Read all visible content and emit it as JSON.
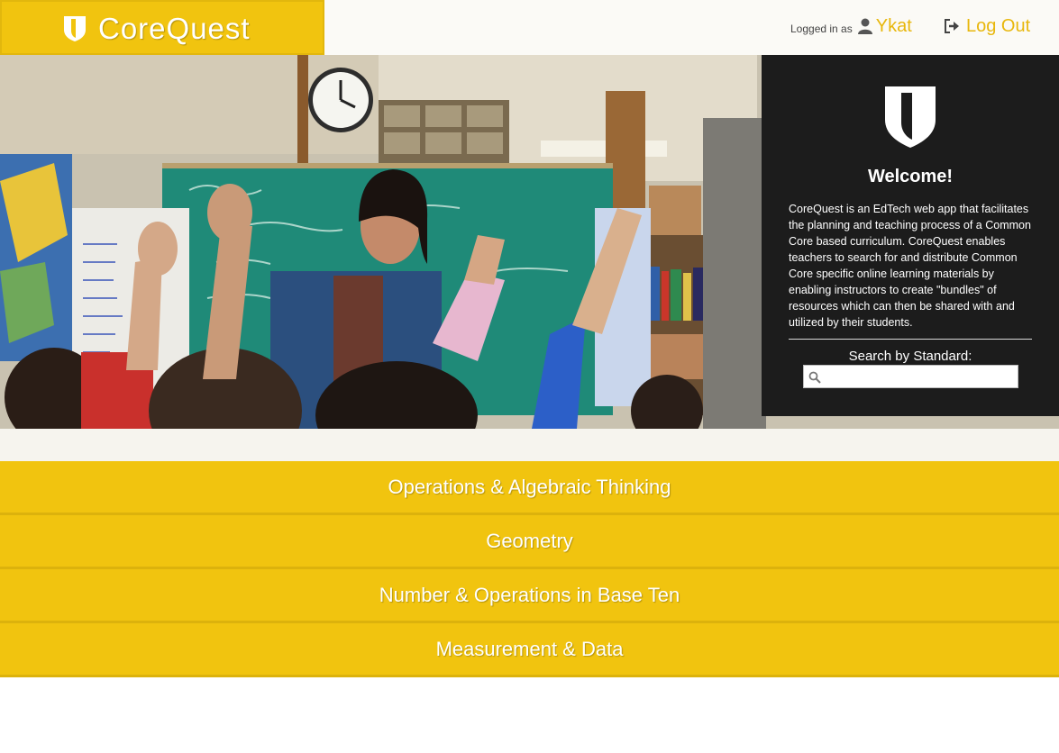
{
  "header": {
    "brand_name": "CoreQuest",
    "logged_in_label": "Logged in as",
    "username": "Ykat",
    "logout_label": "Log Out"
  },
  "welcome": {
    "title": "Welcome!",
    "description": "CoreQuest is an EdTech web app that facilitates the planning and teaching process of a Common Core based curriculum. CoreQuest enables teachers to search for and distribute Common Core specific online learning materials by enabling instructors to create \"bundles\" of resources which can then be shared with and utilized by their students.",
    "search_label": "Search by Standard:",
    "search_placeholder": "",
    "search_value": ""
  },
  "categories": [
    {
      "label": "Operations & Algebraic Thinking"
    },
    {
      "label": "Geometry"
    },
    {
      "label": "Number & Operations in Base Ten"
    },
    {
      "label": "Measurement & Data"
    }
  ],
  "colors": {
    "accent": "#f1c40f",
    "accent_text": "#e8b70c",
    "panel": "#1c1c1c"
  },
  "icons": {
    "logo": "shield-icon",
    "user": "user-icon",
    "logout": "logout-icon",
    "search": "search-icon"
  }
}
